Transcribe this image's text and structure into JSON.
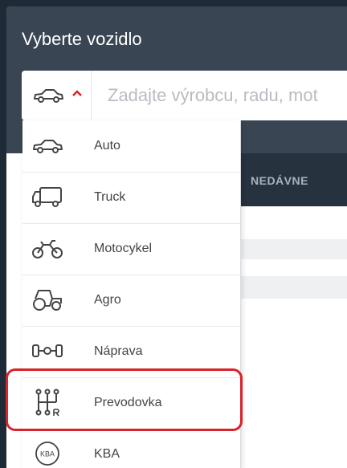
{
  "header": {
    "title": "Vyberte vozidlo"
  },
  "search": {
    "placeholder": "Zadajte výrobcu, radu, mot",
    "selected_type_icon": "car-icon",
    "toggle_icon": "chevron-up-icon"
  },
  "tabs": {
    "recent": "NEDÁVNE"
  },
  "vehicle_types": [
    {
      "label": "Auto",
      "icon": "car-icon"
    },
    {
      "label": "Truck",
      "icon": "truck-icon"
    },
    {
      "label": "Motocykel",
      "icon": "motorcycle-icon"
    },
    {
      "label": "Agro",
      "icon": "tractor-icon"
    },
    {
      "label": "Náprava",
      "icon": "axle-icon"
    },
    {
      "label": "Prevodovka",
      "icon": "gearbox-icon"
    },
    {
      "label": "KBA",
      "icon": "kba-icon"
    }
  ],
  "kba_badge": "KBA",
  "highlighted_item": "Prevodovka",
  "colors": {
    "header": "#3a4553",
    "tabs_bar": "#27323f",
    "highlight": "#d8232a",
    "chevron": "#d8232a"
  }
}
